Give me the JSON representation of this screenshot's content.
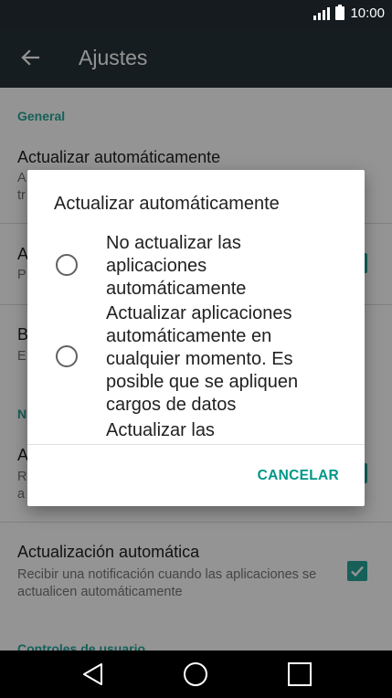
{
  "status_bar": {
    "time": "10:00"
  },
  "app_bar": {
    "title": "Ajustes"
  },
  "settings": {
    "general_header": "General",
    "auto_update": {
      "title": "Actualizar automáticamente",
      "subtitle_peek": "A",
      "subtitle_peek2": "tr"
    },
    "item2": {
      "title_peek": "A",
      "subtitle_peek": "P"
    },
    "item3": {
      "title_peek": "B",
      "subtitle_peek": "E"
    },
    "notifications_header_peek": "N",
    "item4": {
      "title_peek": "A",
      "subtitle_peek": "R",
      "subtitle_peek2": "a"
    },
    "auto_update_notification": {
      "title": "Actualización automática",
      "subtitle": "Recibir una notificación cuando las aplicaciones se actualicen automáticamente",
      "checked": true
    },
    "user_controls_header": "Controles de usuario"
  },
  "dialog": {
    "title": "Actualizar automáticamente",
    "options": [
      {
        "label": "No actualizar las aplicaciones automáticamente",
        "selected": false
      },
      {
        "label": "Actualizar aplicaciones automáticamente en cualquier momento. Es posible que se apliquen cargos de datos",
        "selected": false
      },
      {
        "label": "Actualizar las",
        "selected": false
      }
    ],
    "cancel_label": "CANCELAR"
  },
  "colors": {
    "accent": "#26a69a",
    "app_bar": "#263238",
    "status_bar": "#151b1f"
  },
  "nav_bar": {
    "icons": [
      "back-icon",
      "home-icon",
      "recents-icon"
    ]
  }
}
